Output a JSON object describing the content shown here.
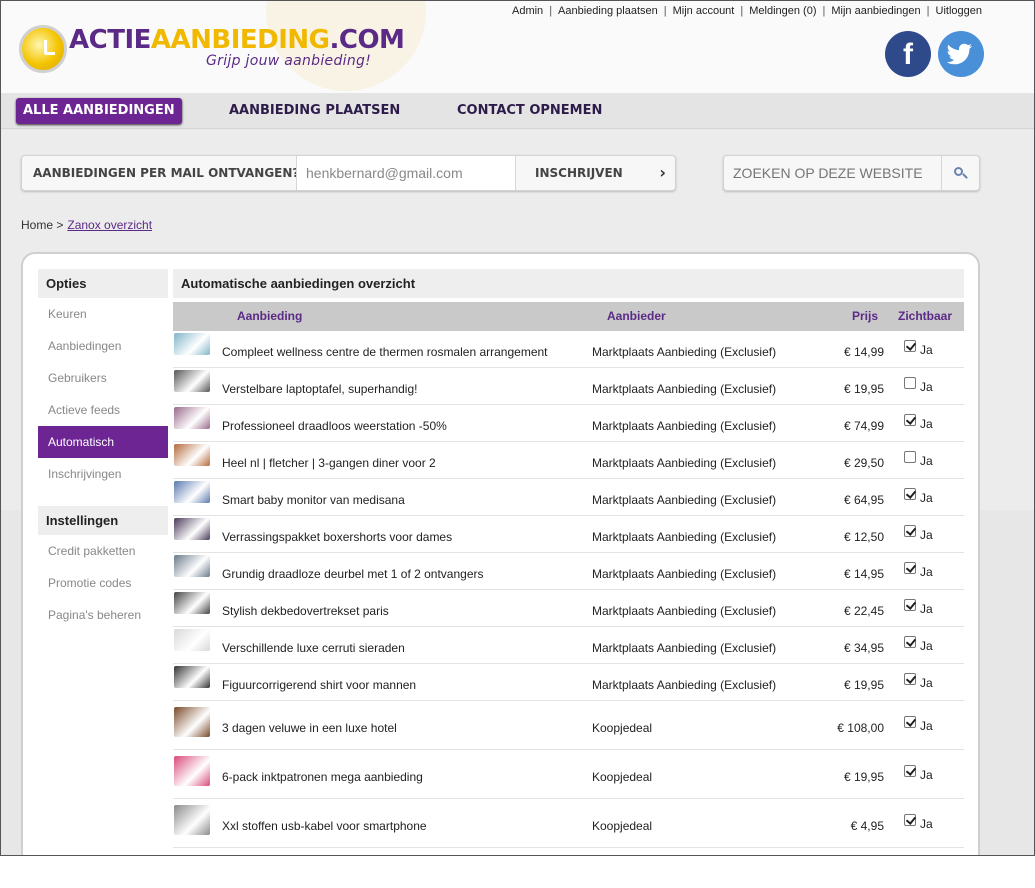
{
  "logo": {
    "part1": "ACTIE",
    "part2": "AANBIEDING",
    "part3": ".COM",
    "tagline": "Grijp jouw aanbieding!"
  },
  "toplinks": [
    "Admin",
    "Aanbieding plaatsen",
    "Mijn account",
    "Meldingen (0)",
    "Mijn aanbiedingen",
    "Uitloggen"
  ],
  "social": {
    "facebook": "f",
    "twitter_icon": "twitter-bird-icon",
    "facebook_color": "#2f4a8b",
    "twitter_color": "#4a90d9"
  },
  "nav": {
    "all": "ALLE AANBIEDINGEN",
    "place": "AANBIEDING PLAATSEN",
    "contact": "CONTACT OPNEMEN"
  },
  "newsletter": {
    "label": "AANBIEDINGEN PER MAIL ONTVANGEN?",
    "email": "henkbernard@gmail.com",
    "button": "INSCHRIJVEN"
  },
  "search": {
    "placeholder": "ZOEKEN OP DEZE WEBSITE"
  },
  "breadcrumb": {
    "home": "Home >",
    "current": "Zanox overzicht"
  },
  "sidebar": {
    "opties_title": "Opties",
    "opties": [
      "Keuren",
      "Aanbiedingen",
      "Gebruikers",
      "Actieve feeds",
      "Automatisch",
      "Inschrijvingen"
    ],
    "instellingen_title": "Instellingen",
    "instellingen": [
      "Credit pakketten",
      "Promotie codes",
      "Pagina's beheren"
    ]
  },
  "main": {
    "title": "Automatische aanbiedingen overzicht",
    "columns": {
      "offer": "Aanbieding",
      "provider": "Aanbieder",
      "price": "Prijs",
      "visible": "Zichtbaar"
    },
    "visible_label": "Ja",
    "rows": [
      {
        "title": "Compleet wellness centre de thermen rosmalen arrangement",
        "provider": "Marktplaats Aanbieding (Exclusief)",
        "price": "€ 14,99",
        "visible": true,
        "thumb": "#7fb6c9"
      },
      {
        "title": "Verstelbare laptoptafel, superhandig!",
        "provider": "Marktplaats Aanbieding (Exclusief)",
        "price": "€ 19,95",
        "visible": false,
        "thumb": "#555555"
      },
      {
        "title": "Professioneel draadloos weerstation -50%",
        "provider": "Marktplaats Aanbieding (Exclusief)",
        "price": "€ 74,99",
        "visible": true,
        "thumb": "#9a6a8a"
      },
      {
        "title": "Heel nl | fletcher | 3-gangen diner voor 2",
        "provider": "Marktplaats Aanbieding (Exclusief)",
        "price": "€ 29,50",
        "visible": false,
        "thumb": "#b46a3c"
      },
      {
        "title": "Smart baby monitor van medisana",
        "provider": "Marktplaats Aanbieding (Exclusief)",
        "price": "€ 64,95",
        "visible": true,
        "thumb": "#5a7ab0"
      },
      {
        "title": "Verrassingspakket boxershorts voor dames",
        "provider": "Marktplaats Aanbieding (Exclusief)",
        "price": "€ 12,50",
        "visible": true,
        "thumb": "#4a3a5a"
      },
      {
        "title": "Grundig draadloze deurbel met 1 of 2 ontvangers",
        "provider": "Marktplaats Aanbieding (Exclusief)",
        "price": "€ 14,95",
        "visible": true,
        "thumb": "#6a7a8a"
      },
      {
        "title": "Stylish dekbedovertrekset paris",
        "provider": "Marktplaats Aanbieding (Exclusief)",
        "price": "€ 22,45",
        "visible": true,
        "thumb": "#444444"
      },
      {
        "title": "Verschillende luxe cerruti sieraden",
        "provider": "Marktplaats Aanbieding (Exclusief)",
        "price": "€ 34,95",
        "visible": true,
        "thumb": "#d8d8d8"
      },
      {
        "title": "Figuurcorrigerend shirt voor mannen",
        "provider": "Marktplaats Aanbieding (Exclusief)",
        "price": "€ 19,95",
        "visible": true,
        "thumb": "#333333"
      },
      {
        "title": "3 dagen veluwe in een luxe hotel",
        "provider": "Koopjedeal",
        "price": "€ 108,00",
        "visible": true,
        "thumb": "#7a4a2a",
        "tall": true
      },
      {
        "title": "6-pack inktpatronen mega aanbieding",
        "provider": "Koopjedeal",
        "price": "€ 19,95",
        "visible": true,
        "thumb": "#d94a7a",
        "tall": true
      },
      {
        "title": "Xxl stoffen usb-kabel voor smartphone",
        "provider": "Koopjedeal",
        "price": "€ 4,95",
        "visible": true,
        "thumb": "#8a8a8a",
        "tall": true
      }
    ]
  }
}
